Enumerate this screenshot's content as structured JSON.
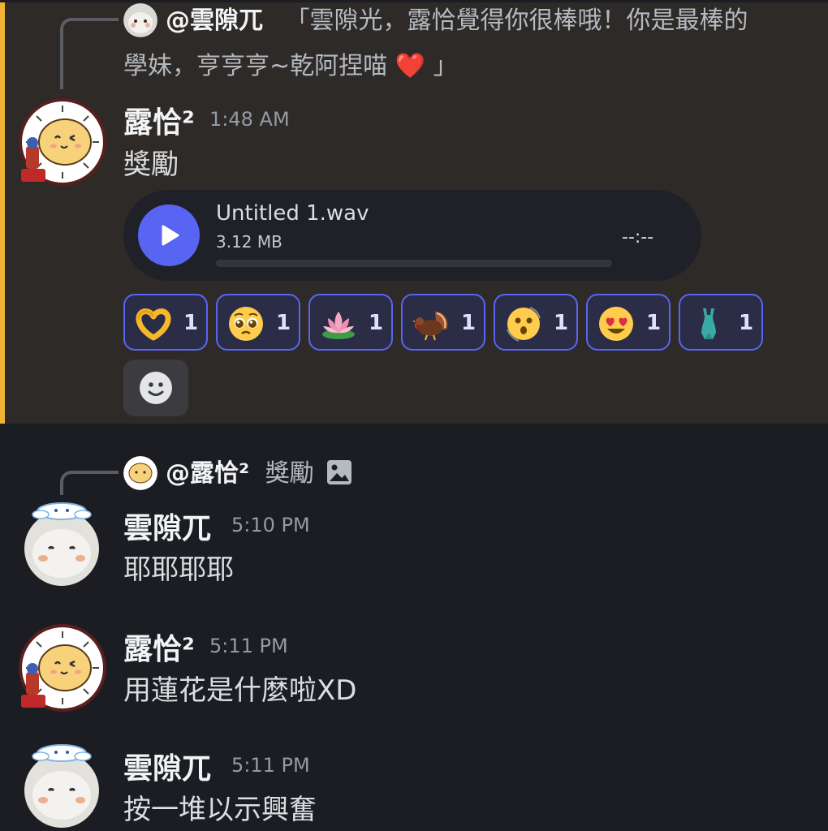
{
  "messages": [
    {
      "reply": {
        "mention": "@雲隙兀",
        "text_line1": "「雲隙光，露恰覺得你很棒哦！你是最棒的",
        "text_line2": "學妹，亨亨亨~乾阿捏喵",
        "heart": "❤️",
        "text_end": "」"
      },
      "username": "露恰²",
      "timestamp": "1:48 AM",
      "content": "獎勵",
      "attachment": {
        "file_name": "Untitled 1.wav",
        "file_size": "3.12 MB",
        "duration": "--:--",
        "progress": 0
      },
      "reactions": [
        {
          "emoji": "heart-hands",
          "count": "1"
        },
        {
          "emoji": "pleading-face",
          "count": "1"
        },
        {
          "emoji": "lotus",
          "count": "1"
        },
        {
          "emoji": "turkey",
          "count": "1"
        },
        {
          "emoji": "dizzy-face",
          "count": "1"
        },
        {
          "emoji": "heart-eyes",
          "count": "1"
        },
        {
          "emoji": "one-piece-swimsuit",
          "count": "1"
        }
      ],
      "highlight_color": "#f0b232"
    },
    {
      "reply": {
        "mention": "@露恰²",
        "text": "獎勵"
      },
      "username": "雲隙兀",
      "timestamp": "5:10 PM",
      "content": "耶耶耶耶"
    },
    {
      "username": "露恰²",
      "timestamp": "5:11 PM",
      "content": "用蓮花是什麼啦XD"
    },
    {
      "username": "雲隙兀",
      "timestamp": "5:11 PM",
      "content": "按一堆以示興奮"
    }
  ],
  "colors": {
    "accent": "#5865f2",
    "background": "#1c1d23",
    "highlight_bg": "#2e2a27"
  }
}
